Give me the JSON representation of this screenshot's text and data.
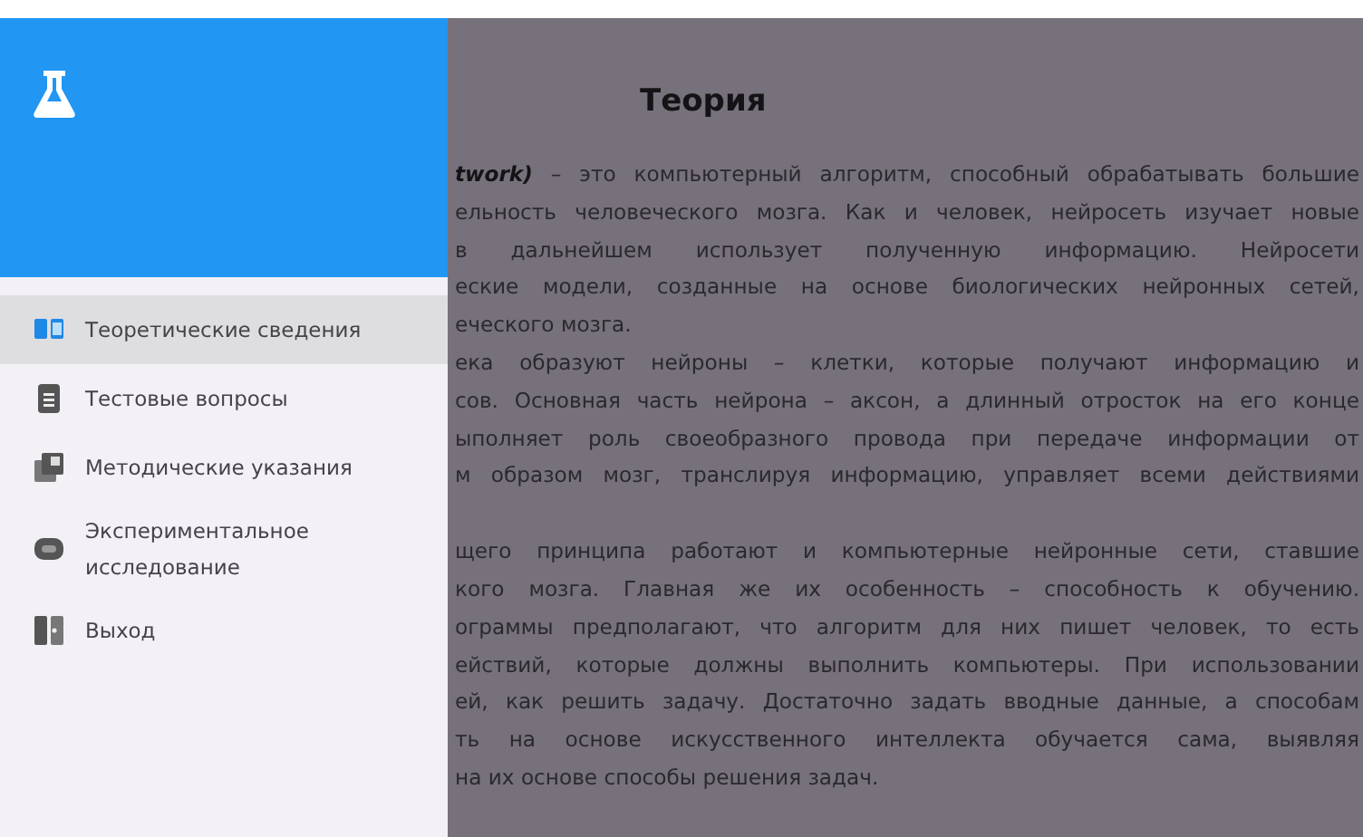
{
  "drawer": {
    "items": [
      {
        "label": "Теоретические сведения",
        "kind": "book",
        "selected": true
      },
      {
        "label": "Тестовые вопросы",
        "kind": "document",
        "selected": false
      },
      {
        "label": "Методические указания",
        "kind": "library",
        "selected": false
      },
      {
        "label": "Экспериментальное исследование",
        "kind": "chip",
        "selected": false
      },
      {
        "label": "Выход",
        "kind": "exit",
        "selected": false
      }
    ]
  },
  "content": {
    "title": "Теория",
    "blocks": [
      [
        {
          "text": "*twork)* – это компьютерный алгоритм, способный обрабатывать большие",
          "ends": false
        },
        {
          "text": "ельность человеческого мозга. Как и человек, нейросеть изучает новые",
          "ends": false
        },
        {
          "text": "в дальнейшем использует полученную информацию. Нейросети",
          "ends": false
        },
        {
          "text": "еские модели, созданные на основе биологических нейронных сетей,",
          "ends": false
        },
        {
          "text": "еческого мозга.",
          "ends": true
        },
        {
          "text": "ека образуют нейроны – клетки, которые получают информацию и",
          "ends": false
        },
        {
          "text": "сов. Основная часть нейрона – аксон, а длинный отросток на его конце",
          "ends": false
        },
        {
          "text": "ыполняет роль своеобразного провода при передаче информации от",
          "ends": false
        },
        {
          "text": "м образом мозг, транслируя информацию, управляет всеми действиями",
          "ends": false
        }
      ],
      [
        {
          "text": "щего принципа работают и компьютерные нейронные сети, ставшие",
          "ends": false
        },
        {
          "text": "кого мозга. Главная же их особенность – способность к обучению.",
          "ends": false
        },
        {
          "text": "ограммы предполагают, что алгоритм для них пишет человек, то есть",
          "ends": false
        },
        {
          "text": "ействий, которые должны выполнить компьютеры. При использовании",
          "ends": false
        },
        {
          "text": "ей, как решить задачу. Достаточно задать вводные данные, а способам",
          "ends": false
        },
        {
          "text": "ть на основе искусственного интеллекта обучается сама, выявляя",
          "ends": false
        },
        {
          "text": "на их основе способы решения задач.",
          "ends": true
        }
      ]
    ]
  }
}
